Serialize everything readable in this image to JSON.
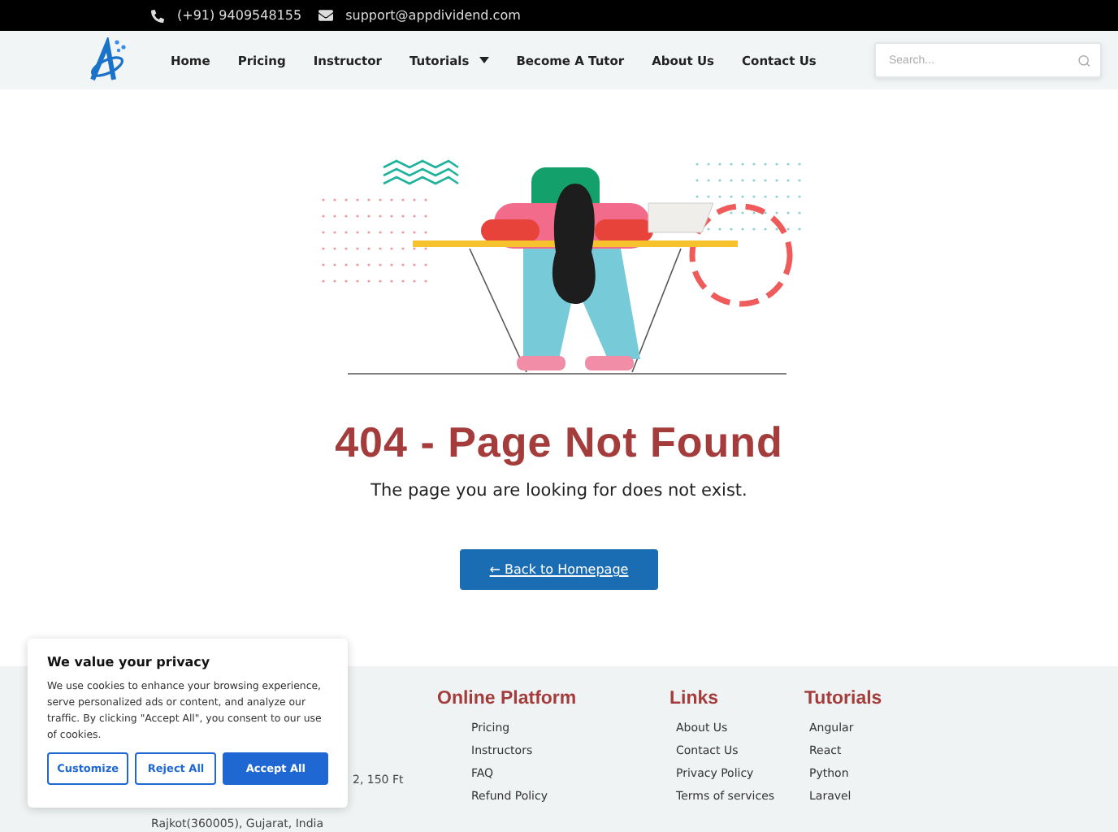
{
  "topbar": {
    "phone": "(+91) 9409548155",
    "email": "support@appdividend.com"
  },
  "nav": {
    "items": [
      {
        "label": "Home",
        "dropdown": false
      },
      {
        "label": "Pricing",
        "dropdown": false
      },
      {
        "label": "Instructor",
        "dropdown": false
      },
      {
        "label": "Tutorials",
        "dropdown": true
      },
      {
        "label": "Become A Tutor",
        "dropdown": false
      },
      {
        "label": "About Us",
        "dropdown": false
      },
      {
        "label": "Contact Us",
        "dropdown": false
      }
    ],
    "search": {
      "placeholder": "Search..."
    }
  },
  "error": {
    "title": "404 - Page Not Found",
    "message": "The page you are looking for does not exist.",
    "button": "← Back to Homepage"
  },
  "footer": {
    "address": [
      "2, 150 Ft",
      "Rajkot(360005), Gujarat, India"
    ],
    "columns": [
      {
        "title": "Online Platform",
        "links": [
          "Pricing",
          "Instructors",
          "FAQ",
          "Refund Policy"
        ]
      },
      {
        "title": "Links",
        "links": [
          "About Us",
          "Contact Us",
          "Privacy Policy",
          "Terms of services"
        ]
      },
      {
        "title": "Tutorials",
        "links": [
          "Angular",
          "React",
          "Python",
          "Laravel"
        ]
      }
    ]
  },
  "cookie": {
    "title": "We value your privacy",
    "text": "We use cookies to enhance your browsing experience, serve personalized ads or content, and analyze our traffic. By clicking \"Accept All\", you consent to our use of cookies.",
    "buttons": [
      {
        "label": "Customize",
        "kind": "outline"
      },
      {
        "label": "Reject All",
        "kind": "outline"
      },
      {
        "label": "Accept All",
        "kind": "primary"
      }
    ]
  }
}
